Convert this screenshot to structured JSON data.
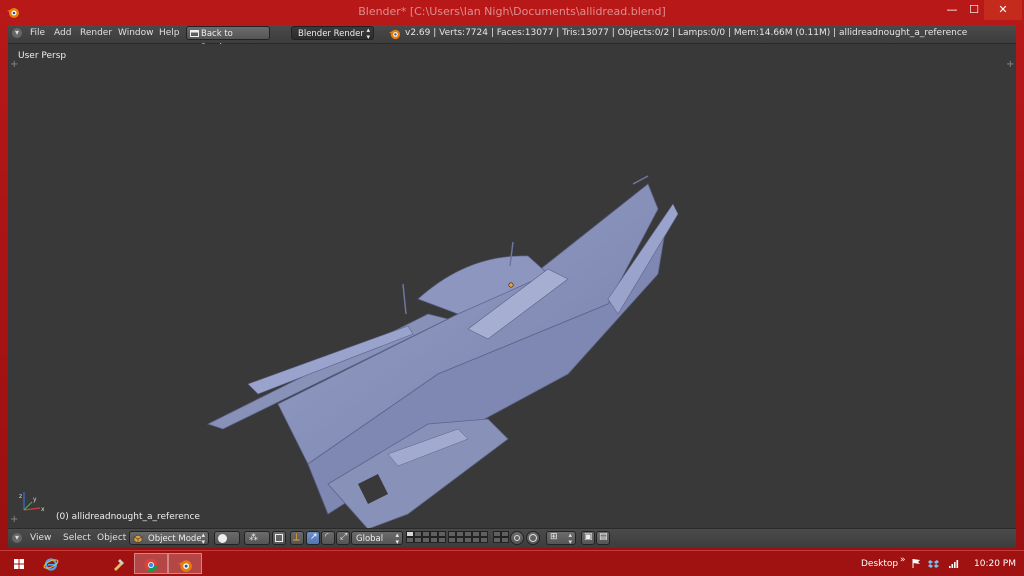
{
  "window": {
    "title": "Blender* [C:\\Users\\Ian Nigh\\Documents\\allidread.blend]",
    "minimize": "—",
    "maximize": "☐",
    "close": "✕"
  },
  "info_header": {
    "menus": [
      "File",
      "Add",
      "Render",
      "Window",
      "Help"
    ],
    "back_button": "Back to Previous",
    "render_engine": "Blender Render",
    "stats": "v2.69 | Verts:7724 | Faces:13077 | Tris:13077 | Objects:0/2 | Lamps:0/0 | Mem:14.66M (0.11M) | allidreadnought_a_reference"
  },
  "viewport": {
    "view_label": "User Persp",
    "object_label": "(0) allidreadnought_a_reference",
    "model_color": "#8891b8"
  },
  "view_header": {
    "menus": [
      "View",
      "Select",
      "Object"
    ],
    "mode": "Object Mode",
    "orientation": "Global"
  },
  "taskbar": {
    "apps": [
      "start-icon",
      "ie-icon",
      "tools-icon",
      "chrome-icon",
      "blender-icon"
    ],
    "desktop_label": "Desktop",
    "chevron": "»",
    "clock": "10:20 PM"
  },
  "colors": {
    "frame": "#a01515",
    "viewport_bg": "#393939",
    "header_bg": "#444444",
    "active_tool": "#5577b0"
  }
}
